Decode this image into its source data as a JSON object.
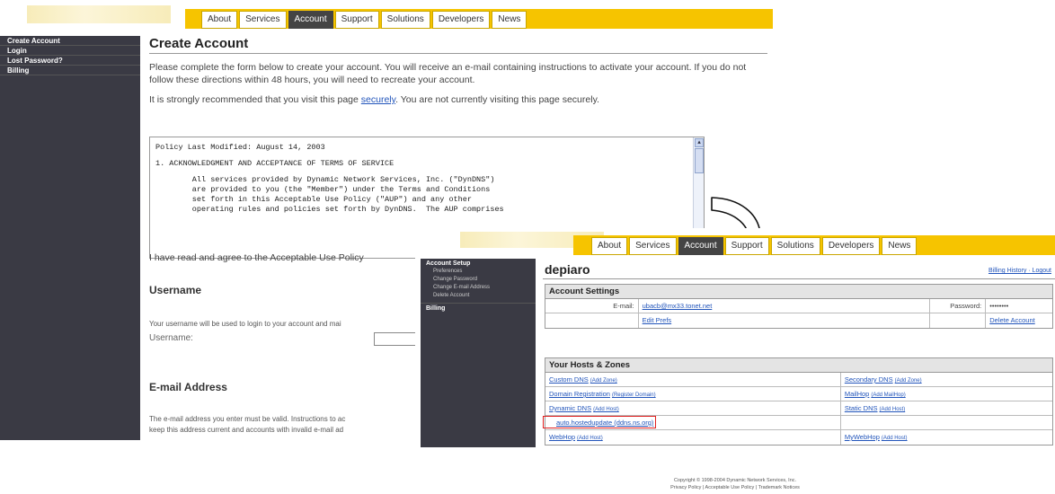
{
  "screen1": {
    "tabs": [
      {
        "label": "About",
        "active": false
      },
      {
        "label": "Services",
        "active": false
      },
      {
        "label": "Account",
        "active": true
      },
      {
        "label": "Support",
        "active": false
      },
      {
        "label": "Solutions",
        "active": false
      },
      {
        "label": "Developers",
        "active": false
      },
      {
        "label": "News",
        "active": false
      }
    ],
    "sidebar": [
      "Create Account",
      "Login",
      "Lost Password?",
      "Billing"
    ],
    "title": "Create Account",
    "intro": "Please complete the form below to create your account. You will receive an e-mail containing instructions to activate your account. If you do not follow these directions within 48 hours, you will need to recreate your account.",
    "secure_pre": "It is strongly recommended that you visit this page ",
    "secure_link": "securely",
    "secure_post": ". You are not currently visiting this page securely.",
    "policy_lines": [
      "Policy Last Modified: August 14, 2003",
      "",
      "1. ACKNOWLEDGMENT AND ACCEPTANCE OF TERMS OF SERVICE",
      "",
      "        All services provided by Dynamic Network Services, Inc. (\"DynDNS\")",
      "        are provided to you (the \"Member\") under the Terms and Conditions",
      "        set forth in this Acceptable Use Policy (\"AUP\") and any other",
      "        operating rules and policies set forth by DynDNS.  The AUP comprises"
    ],
    "agree_text": "I have read and agree to the Acceptable Use Policy",
    "username_title": "Username",
    "username_help": "Your username will be used to login to your account and mai",
    "username_label": "Username:",
    "email_title": "E-mail Address",
    "email_help_1": "The e-mail address you enter must be valid. Instructions to ac",
    "email_help_2": "keep this address current and accounts with invalid e-mail ad"
  },
  "screen2": {
    "tabs": [
      {
        "label": "About",
        "active": false
      },
      {
        "label": "Services",
        "active": false
      },
      {
        "label": "Account",
        "active": true
      },
      {
        "label": "Support",
        "active": false
      },
      {
        "label": "Solutions",
        "active": false
      },
      {
        "label": "Developers",
        "active": false
      },
      {
        "label": "News",
        "active": false
      }
    ],
    "sidebar_head": "Account Setup",
    "sidebar_subs": [
      "Preferences",
      "Change Password",
      "Change E-mail Address",
      "Delete Account"
    ],
    "sidebar_billing": "Billing",
    "username": "depiaro",
    "top_links": "Billing History · Logout",
    "account_settings": {
      "title": "Account Settings",
      "email_label": "E-mail:",
      "email_value": "ubacb@mx33.tonet.net",
      "password_label": "Password:",
      "password_value": "••••••••",
      "edit_prefs": "Edit Prefs",
      "delete_account": "Delete Account"
    },
    "hosts": {
      "title": "Your Hosts & Zones",
      "rows": [
        [
          {
            "name": "Custom DNS",
            "add": "(Add Zone)"
          },
          {
            "name": "Secondary DNS",
            "add": "(Add Zone)"
          }
        ],
        [
          {
            "name": "Domain Registration",
            "add": "(Register Domain)"
          },
          {
            "name": "MailHop",
            "add": "(Add MailHop)"
          }
        ],
        [
          {
            "name": "Dynamic DNS",
            "add": "(Add Host)"
          },
          {
            "name": "Static DNS",
            "add": "(Add Host)"
          }
        ],
        [
          {
            "name": "auto.hostedupdate (ddns.ns.org)",
            "add": ""
          },
          {
            "name": "",
            "add": ""
          }
        ],
        [
          {
            "name": "WebHop",
            "add": "(Add Host)"
          },
          {
            "name": "MyWebHop",
            "add": "(Add Host)"
          }
        ]
      ]
    },
    "footer_1": "Copyright © 1998-2004 Dynamic Network Services, Inc.",
    "footer_2": "Privacy Policy | Acceptable Use Policy | Trademark Notices"
  }
}
